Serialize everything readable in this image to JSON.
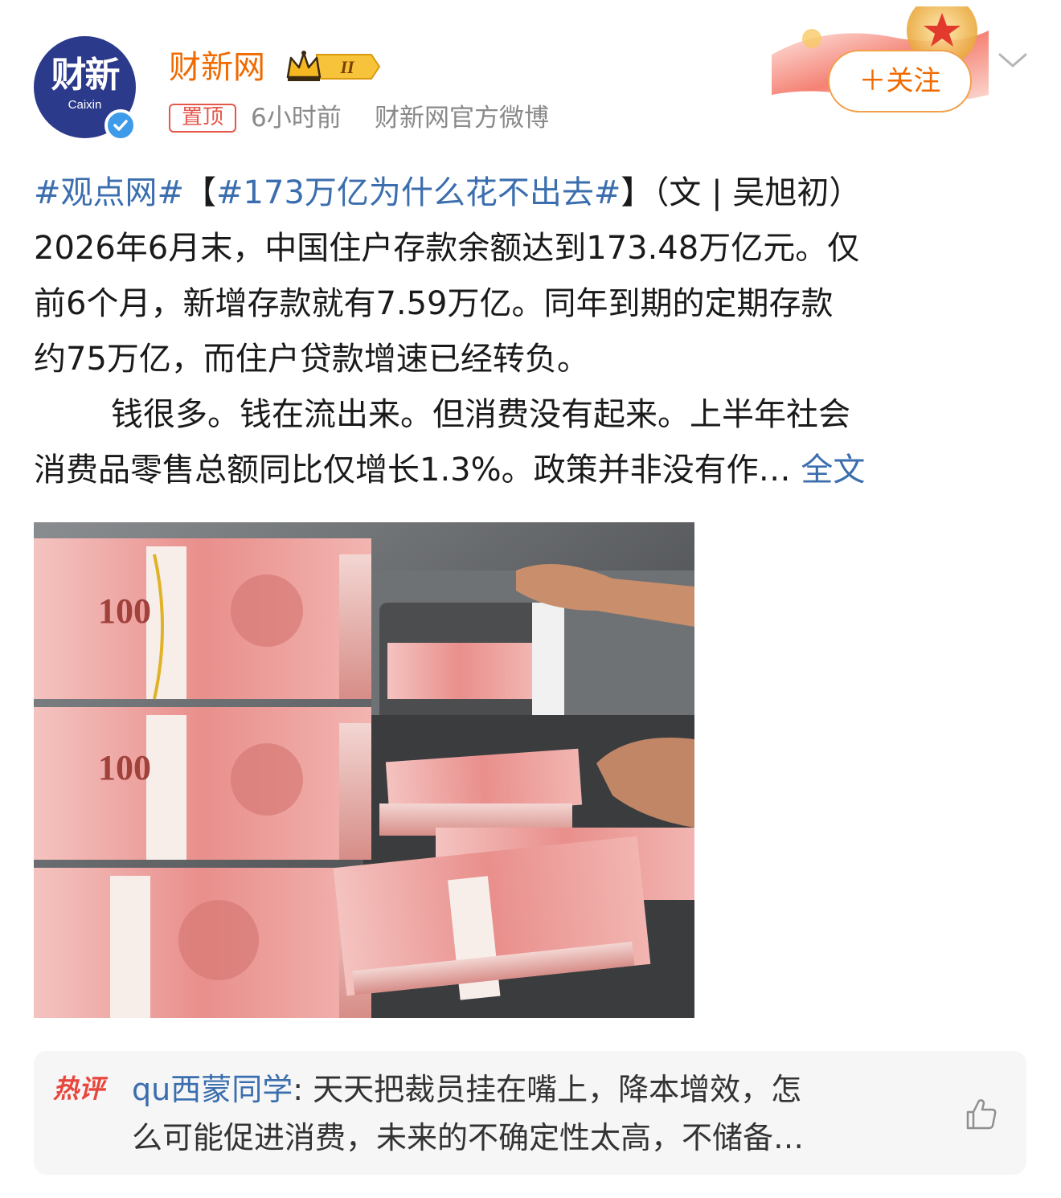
{
  "author": {
    "avatar_text": "财新",
    "avatar_subtext": "Caixin",
    "name": "财新网",
    "vip_level": "II",
    "pinned_label": "置顶",
    "time": "6小时前",
    "source": "财新网官方微博",
    "follow_label": "＋关注"
  },
  "post": {
    "hashtag1": "#观点网#",
    "bracket_open": "【",
    "hashtag2": "#173万亿为什么花不出去#",
    "bracket_close": "】",
    "byline": "（文 | 吴旭初）",
    "line2": "2026年6月末，中国住户存款余额达到173.48万亿元。仅",
    "line3": "前6个月，新增存款就有7.59万亿。同年到期的定期存款",
    "line4": "约75万亿，而住户贷款增速已经转负。",
    "line5": "钱很多。钱在流出来。但消费没有起来。上半年社会",
    "line6": "消费品零售总额同比仅增长1.3%。政策并非没有作…",
    "more_label": "全文"
  },
  "image": {
    "banknote_label": "100"
  },
  "hot_comment": {
    "label": "热评",
    "commenter": "qu西蒙同学",
    "line1": ": 天天把裁员挂在嘴上，降本增效，怎",
    "line2": "么可能促进消费，未来的不确定性太高，不储备…"
  },
  "icons": {
    "verified": "verified-check-icon",
    "chevron": "chevron-down-icon",
    "like": "thumbs-up-icon"
  },
  "colors": {
    "accent_orange": "#f06a00",
    "link_blue": "#3b6eae",
    "pin_red": "#e5574b",
    "verified_blue": "#3d9be9"
  }
}
